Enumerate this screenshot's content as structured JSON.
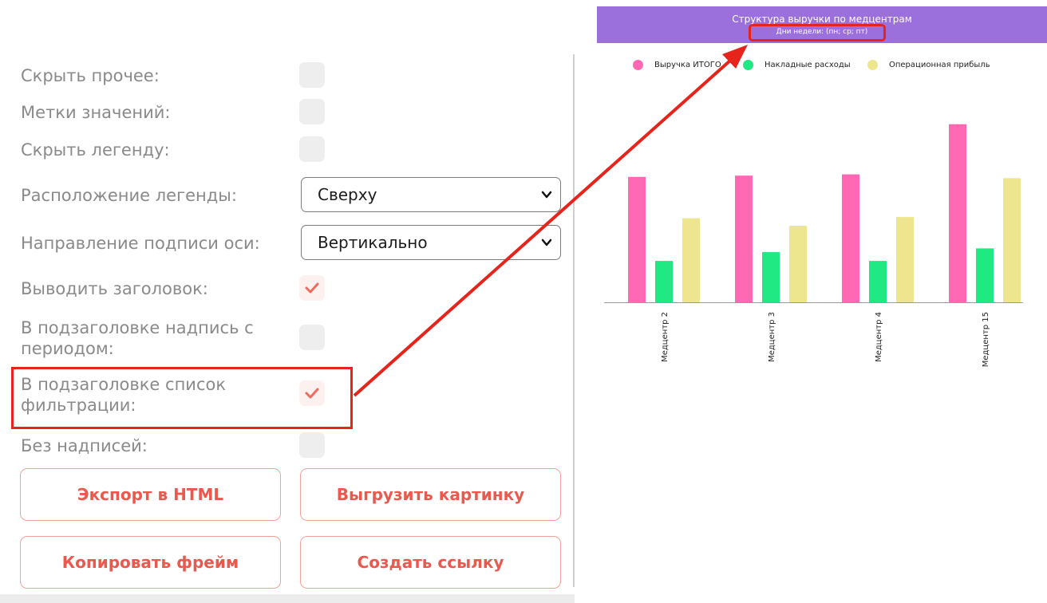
{
  "settings": {
    "hide_other_label": "Скрыть прочее:",
    "value_labels_label": "Метки значений:",
    "hide_legend_label": "Скрыть легенду:",
    "legend_position_label": "Расположение легенды:",
    "legend_position_value": "Сверху",
    "axis_label_direction_label": "Направление подписи оси:",
    "axis_label_direction_value": "Вертикально",
    "show_title_label": "Выводить заголовок:",
    "subtitle_period_label_line1": "В подзаголовке надпись с",
    "subtitle_period_label_line2": "периодом:",
    "subtitle_filter_label_line1": "В подзаголовке список",
    "subtitle_filter_label_line2": "фильтрации:",
    "no_labels_label": "Без надписей:",
    "checked": {
      "hide_other": false,
      "value_labels": false,
      "hide_legend": false,
      "show_title": true,
      "subtitle_period": false,
      "subtitle_filter": true,
      "no_labels": false
    }
  },
  "buttons": {
    "export_html": "Экспорт в HTML",
    "download_image": "Выгрузить картинку",
    "copy_frame": "Копировать фрейм",
    "create_link": "Создать ссылку"
  },
  "colors": {
    "accent": "#e9594d",
    "annotation": "#e6241b",
    "header": "#9b6fdc"
  },
  "chart_data": {
    "type": "bar",
    "title": "Структура выручки по медцентрам",
    "subtitle": "Дни недели: (пн; ср; пт)",
    "legend_position": "top",
    "categories": [
      "Медцентр 2",
      "Медцентр 3",
      "Медцентр 4",
      "Медцентр 15"
    ],
    "series": [
      {
        "name": "Выручка ИТОГО",
        "color": "#ff69b4",
        "values": [
          100,
          101,
          102,
          142
        ]
      },
      {
        "name": "Накладные расходы",
        "color": "#20e882",
        "values": [
          33,
          40,
          33,
          43
        ]
      },
      {
        "name": "Операционная прибыль",
        "color": "#ede68f",
        "values": [
          67,
          61,
          68,
          99
        ]
      }
    ],
    "ylim": [
      0,
      145
    ],
    "x_label_orientation": "vertical",
    "grid": false
  }
}
